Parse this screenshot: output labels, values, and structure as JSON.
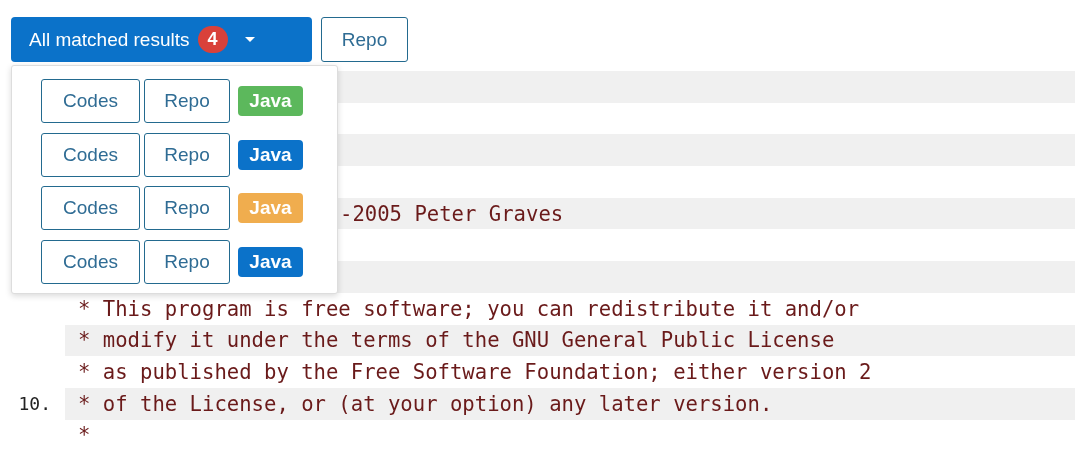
{
  "toolbar": {
    "results_button": {
      "label": "All matched results",
      "count": "4"
    },
    "repo_button": "Repo"
  },
  "dropdown": {
    "open": true,
    "items": [
      {
        "codes": "Codes",
        "repo": "Repo",
        "language": "Java",
        "color": "#5cb85c"
      },
      {
        "codes": "Codes",
        "repo": "Repo",
        "language": "Java",
        "color": "#0b72c9"
      },
      {
        "codes": "Codes",
        "repo": "Repo",
        "language": "Java",
        "color": "#f0ad4e"
      },
      {
        "codes": "Codes",
        "repo": "Repo",
        "language": "Java",
        "color": "#0b72c9"
      }
    ]
  },
  "code": {
    "rows": [
      {
        "kind": "blank"
      },
      {
        "kind": "blank"
      },
      {
        "kind": "blank"
      },
      {
        "kind": "blank"
      },
      {
        "kind": "covered",
        "text": "-2005 Peter Graves"
      },
      {
        "kind": "blank"
      },
      {
        "kind": "blank"
      },
      {
        "kind": "code",
        "text": "* This program is free software; you can redistribute it and/or"
      },
      {
        "kind": "code",
        "text": "* modify it under the terms of the GNU General Public License"
      },
      {
        "kind": "code",
        "text": "* as published by the Free Software Foundation; either version 2"
      },
      {
        "kind": "code",
        "number": "10.",
        "text": "* of the License, or (at your option) any later version."
      },
      {
        "kind": "code",
        "text": "*"
      }
    ]
  }
}
